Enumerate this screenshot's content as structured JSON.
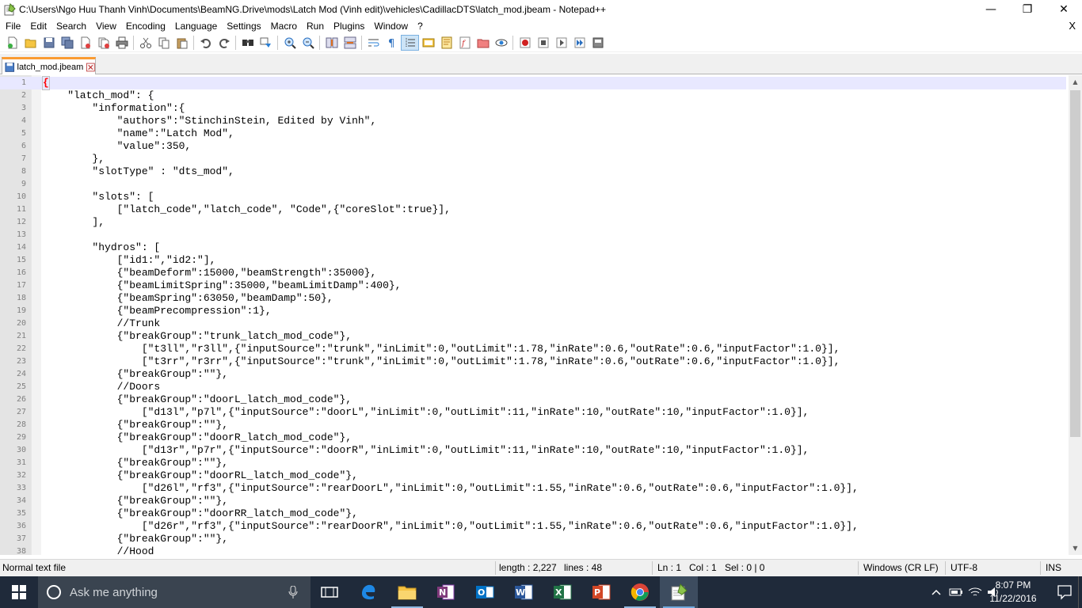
{
  "window": {
    "title": "C:\\Users\\Ngo Huu Thanh Vinh\\Documents\\BeamNG.Drive\\mods\\Latch Mod (Vinh edit)\\vehicles\\CadillacDTS\\latch_mod.jbeam - Notepad++",
    "minimize": "—",
    "maximize": "❐",
    "close": "✕"
  },
  "menu": {
    "items": [
      "File",
      "Edit",
      "Search",
      "View",
      "Encoding",
      "Language",
      "Settings",
      "Macro",
      "Run",
      "Plugins",
      "Window",
      "?"
    ],
    "close": "X"
  },
  "tab": {
    "label": "latch_mod.jbeam"
  },
  "editor": {
    "lines": [
      {
        "n": "1",
        "text": "{"
      },
      {
        "n": "2",
        "text": "    \"latch_mod\": {"
      },
      {
        "n": "3",
        "text": "        \"information\":{"
      },
      {
        "n": "4",
        "text": "            \"authors\":\"StinchinStein, Edited by Vinh\","
      },
      {
        "n": "5",
        "text": "            \"name\":\"Latch Mod\","
      },
      {
        "n": "6",
        "text": "            \"value\":350,"
      },
      {
        "n": "7",
        "text": "        },"
      },
      {
        "n": "8",
        "text": "        \"slotType\" : \"dts_mod\","
      },
      {
        "n": "9",
        "text": ""
      },
      {
        "n": "10",
        "text": "        \"slots\": ["
      },
      {
        "n": "11",
        "text": "            [\"latch_code\",\"latch_code\", \"Code\",{\"coreSlot\":true}],"
      },
      {
        "n": "12",
        "text": "        ],"
      },
      {
        "n": "13",
        "text": ""
      },
      {
        "n": "14",
        "text": "        \"hydros\": ["
      },
      {
        "n": "15",
        "text": "            [\"id1:\",\"id2:\"],"
      },
      {
        "n": "16",
        "text": "            {\"beamDeform\":15000,\"beamStrength\":35000},"
      },
      {
        "n": "17",
        "text": "            {\"beamLimitSpring\":35000,\"beamLimitDamp\":400},"
      },
      {
        "n": "18",
        "text": "            {\"beamSpring\":63050,\"beamDamp\":50},"
      },
      {
        "n": "19",
        "text": "            {\"beamPrecompression\":1},"
      },
      {
        "n": "20",
        "text": "            //Trunk"
      },
      {
        "n": "21",
        "text": "            {\"breakGroup\":\"trunk_latch_mod_code\"},"
      },
      {
        "n": "22",
        "text": "                [\"t3ll\",\"r3ll\",{\"inputSource\":\"trunk\",\"inLimit\":0,\"outLimit\":1.78,\"inRate\":0.6,\"outRate\":0.6,\"inputFactor\":1.0}],"
      },
      {
        "n": "23",
        "text": "                [\"t3rr\",\"r3rr\",{\"inputSource\":\"trunk\",\"inLimit\":0,\"outLimit\":1.78,\"inRate\":0.6,\"outRate\":0.6,\"inputFactor\":1.0}],"
      },
      {
        "n": "24",
        "text": "            {\"breakGroup\":\"\"},"
      },
      {
        "n": "25",
        "text": "            //Doors"
      },
      {
        "n": "26",
        "text": "            {\"breakGroup\":\"doorL_latch_mod_code\"},"
      },
      {
        "n": "27",
        "text": "                [\"d13l\",\"p7l\",{\"inputSource\":\"doorL\",\"inLimit\":0,\"outLimit\":11,\"inRate\":10,\"outRate\":10,\"inputFactor\":1.0}],"
      },
      {
        "n": "28",
        "text": "            {\"breakGroup\":\"\"},"
      },
      {
        "n": "29",
        "text": "            {\"breakGroup\":\"doorR_latch_mod_code\"},"
      },
      {
        "n": "30",
        "text": "                [\"d13r\",\"p7r\",{\"inputSource\":\"doorR\",\"inLimit\":0,\"outLimit\":11,\"inRate\":10,\"outRate\":10,\"inputFactor\":1.0}],"
      },
      {
        "n": "31",
        "text": "            {\"breakGroup\":\"\"},"
      },
      {
        "n": "32",
        "text": "            {\"breakGroup\":\"doorRL_latch_mod_code\"},"
      },
      {
        "n": "33",
        "text": "                [\"d26l\",\"rf3\",{\"inputSource\":\"rearDoorL\",\"inLimit\":0,\"outLimit\":1.55,\"inRate\":0.6,\"outRate\":0.6,\"inputFactor\":1.0}],"
      },
      {
        "n": "34",
        "text": "            {\"breakGroup\":\"\"},"
      },
      {
        "n": "35",
        "text": "            {\"breakGroup\":\"doorRR_latch_mod_code\"},"
      },
      {
        "n": "36",
        "text": "                [\"d26r\",\"rf3\",{\"inputSource\":\"rearDoorR\",\"inLimit\":0,\"outLimit\":1.55,\"inRate\":0.6,\"outRate\":0.6,\"inputFactor\":1.0}],"
      },
      {
        "n": "37",
        "text": "            {\"breakGroup\":\"\"},"
      },
      {
        "n": "38",
        "text": "            //Hood"
      }
    ]
  },
  "status": {
    "file_type": "Normal text file",
    "length": "length : 2,227",
    "lines": "lines : 48",
    "ln": "Ln : 1",
    "col": "Col : 1",
    "sel": "Sel : 0 | 0",
    "eol": "Windows (CR LF)",
    "encoding": "UTF-8",
    "mode": "INS"
  },
  "taskbar": {
    "search_placeholder": "Ask me anything",
    "time": "8:07 PM",
    "date": "11/22/2016"
  },
  "colors": {
    "tab_accent": "#fa9b32",
    "current_line": "#e8e8ff",
    "taskbar_bg": "#1f2a3a"
  }
}
